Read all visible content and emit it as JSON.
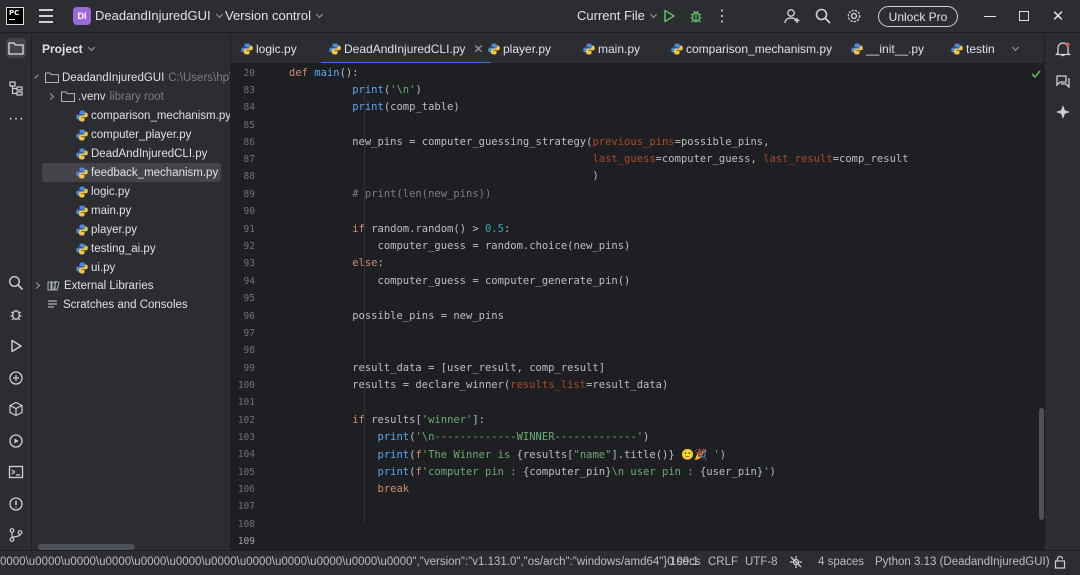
{
  "titlebar": {
    "app_logo": "PC",
    "project_badge": "DI",
    "project_name": "DeadandInjuredGUI",
    "version_control": "Version control",
    "run_config": "Current File",
    "unlock": "Unlock Pro"
  },
  "project_panel": {
    "header": "Project",
    "root": {
      "name": "DeadandInjuredGUI",
      "path": "C:\\Users\\hp\\P"
    },
    "venv": {
      "name": ".venv",
      "note": "library root"
    },
    "files": [
      "comparison_mechanism.py",
      "computer_player.py",
      "DeadAndInjuredCLI.py",
      "feedback_mechanism.py",
      "logic.py",
      "main.py",
      "player.py",
      "testing_ai.py",
      "ui.py"
    ],
    "external_libraries": "External Libraries",
    "scratches": "Scratches and Consoles"
  },
  "tabs": [
    {
      "label": "logic.py"
    },
    {
      "label": "DeadAndInjuredCLI.py"
    },
    {
      "label": "player.py"
    },
    {
      "label": "main.py"
    },
    {
      "label": "comparison_mechanism.py"
    },
    {
      "label": "__init__.py"
    },
    {
      "label": "testin"
    }
  ],
  "editor": {
    "line_numbers": [
      "20",
      "83",
      "84",
      "85",
      "86",
      "87",
      "88",
      "89",
      "90",
      "91",
      "92",
      "93",
      "94",
      "95",
      "96",
      "97",
      "98",
      "99",
      "100",
      "101",
      "102",
      "103",
      "104",
      "105",
      "106",
      "107",
      "108",
      "109"
    ]
  },
  "statusbar": {
    "message": "0000\\u0000\\u0000\\u0000\\u0000\\u0000\\u0000\\u0000\\u0000\\u0000\\u0000\\u0000\",\"version\":\"v1.131.0\",\"os/arch\":\"windows/amd64\"}0 secs",
    "position": "109:1",
    "line_sep": "CRLF",
    "encoding": "UTF-8",
    "indent": "4 spaces",
    "interpreter": "Python 3.13 (DeadandInjuredGUI)"
  },
  "colors": {
    "background": "#1e1f22",
    "panel": "#2b2d30",
    "accent": "#3574f0",
    "keyword": "#cf8e6d",
    "string": "#6aab73",
    "function": "#56a8f5",
    "number": "#2aacb8",
    "param": "#aa4926"
  }
}
